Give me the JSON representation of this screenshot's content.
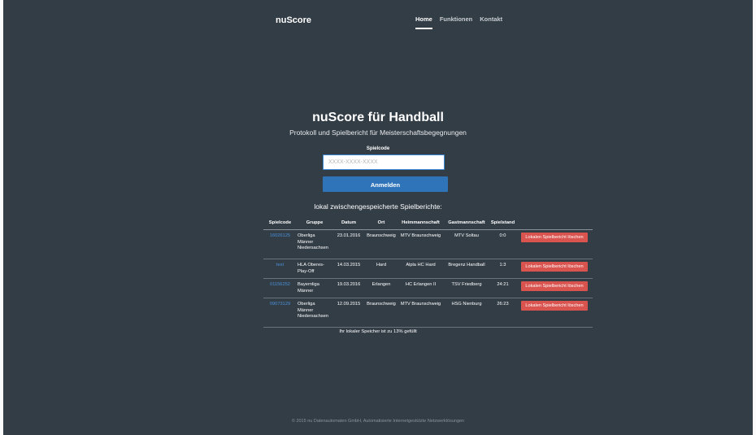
{
  "header": {
    "brand": "nuScore",
    "nav": [
      {
        "label": "Home",
        "active": true
      },
      {
        "label": "Funktionen",
        "active": false
      },
      {
        "label": "Kontakt",
        "active": false
      }
    ]
  },
  "hero": {
    "title": "nuScore für Handball",
    "subtitle": "Protokoll und Spielbericht für Meisterschaftsbegegnungen"
  },
  "login": {
    "label": "Spielcode",
    "placeholder": "XXXX-XXXX-XXXX",
    "value": "",
    "button": "Anmelden"
  },
  "table": {
    "heading": "lokal zwischengespeicherte Spielberichte:",
    "columns": [
      "Spielcode",
      "Gruppe",
      "Datum",
      "Ort",
      "Heimmannschaft",
      "Gastmannschaft",
      "Spielstand",
      ""
    ],
    "rows": [
      {
        "code": "16026125",
        "group": "Oberliga Männer Niedersachsen",
        "date": "23.01.2016",
        "place": "Braunschweig",
        "home": "MTV Braunschweig",
        "guest": "MTV Soltau",
        "score": "0:0",
        "action": "Lokalen Spielbericht löschen"
      },
      {
        "code": "test",
        "group": "HLA Oberes-Play-Off",
        "date": "14.03.2015",
        "place": "Hard",
        "home": "Alpla HC Hard",
        "guest": "Bregenz Handball",
        "score": "1:3",
        "action": "Lokalen Spielbericht löschen"
      },
      {
        "code": "01156252",
        "group": "Bayernliga Männer",
        "date": "19.03.2016",
        "place": "Erlangen",
        "home": "HC Erlangen II",
        "guest": "TSV Friedberg",
        "score": "24:21",
        "action": "Lokalen Spielbericht löschen"
      },
      {
        "code": "09073129",
        "group": "Oberliga Männer Niedersachsen",
        "date": "12.09.2015",
        "place": "Braunschweig",
        "home": "MTV Braunschweig",
        "guest": "HSG Nienburg",
        "score": "26:23",
        "action": "Lokalen Spielbericht löschen"
      }
    ]
  },
  "storage_note": "Ihr lokaler Speicher ist zu 13% gefüllt",
  "footer": "© 2015 nu Datenautomaten GmbH, Automatisierte Internetgestützte Netzwerklösungen"
}
